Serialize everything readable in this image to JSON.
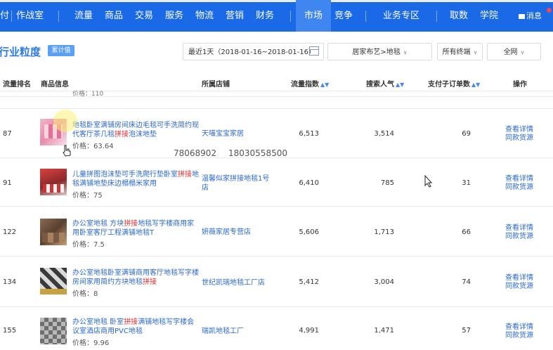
{
  "nav": {
    "items": [
      "付",
      "作战室",
      "流量",
      "商品",
      "交易",
      "服务",
      "物流",
      "营销",
      "财务",
      "市场",
      "竞争",
      "业务专区",
      "取数",
      "学院"
    ],
    "active": "市场",
    "message_label": "消息"
  },
  "page": {
    "title": "行业粒度",
    "tag": "累计值"
  },
  "filters": {
    "date_range": "最近1天（2018-01-16~2018-01-16）",
    "category": "居家布艺>地毯",
    "terminal": "所有终端",
    "site": "全网"
  },
  "table": {
    "headers": {
      "rank": "流量排名",
      "product": "商品信息",
      "shop": "所属店铺",
      "traffic": "流量指数",
      "search": "搜索人气",
      "orders": "支付子订单数",
      "action": "操作"
    },
    "partial_price": "价格：110",
    "rows": [
      {
        "rank": "87",
        "title_parts": [
          "地毯卧室满铺房间床边毛毯可手洗简约现代客厅茶几毯",
          "拼接",
          "泡沫地垫"
        ],
        "price": "价格：63.64",
        "shop": "天喵宝宝家居",
        "traffic": "6,513",
        "search": "3,514",
        "orders": "69",
        "action1": "查看详情",
        "action2": "同款货源"
      },
      {
        "rank": "91",
        "title_parts": [
          "儿童拼图泡沫垫可手洗爬行垫卧室",
          "拼接",
          "地毯满铺地垫床边榻榻米家用"
        ],
        "price": "价格：75",
        "shop": "温馨似家拼接地毯1号店",
        "traffic": "6,410",
        "search": "785",
        "orders": "31",
        "action1": "查看详情",
        "action2": "同款货源"
      },
      {
        "rank": "122",
        "title_parts": [
          "办公室地毯 方块",
          "拼接",
          "地毯写字楼商用家用卧室客厅工程满铺地毯T"
        ],
        "price": "价格：7.5",
        "shop": "妍薇家居专营店",
        "traffic": "5,606",
        "search": "1,713",
        "orders": "66",
        "action1": "查看详情",
        "action2": "同款货源"
      },
      {
        "rank": "134",
        "title_parts": [
          "办公室地毯卧室满铺商用客厅地毯写字楼房间家用简约方块地毯",
          "拼接",
          ""
        ],
        "price": "价格：8",
        "shop": "世纪凯瑞地毯工厂店",
        "traffic": "5,412",
        "search": "3,004",
        "orders": "74",
        "action1": "查看详情",
        "action2": "同款货源"
      },
      {
        "rank": "155",
        "title_parts": [
          "办公室地毯 卧室",
          "拼接",
          "满铺地毯写字楼会议室酒店商用PVC地毯"
        ],
        "price": "价格：9.96",
        "shop": "瑞凯地毯工厂",
        "traffic": "4,991",
        "search": "1,471",
        "orders": "57",
        "action1": "查看详情",
        "action2": "同款货源"
      }
    ]
  },
  "watermark": {
    "left": "78068902",
    "right": "18030558500"
  }
}
